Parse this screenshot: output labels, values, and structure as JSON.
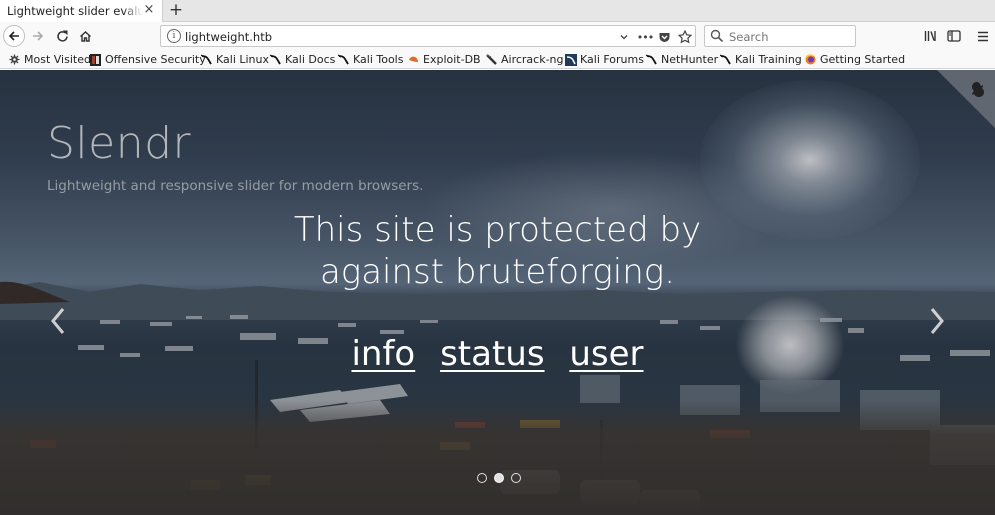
{
  "browser": {
    "tab_title": "Lightweight slider evaluation",
    "tab_close": "×",
    "new_tab": "+",
    "url": "lightweight.htb",
    "url_info": "i",
    "search_placeholder": "Search",
    "page_actions": "•••"
  },
  "bookmarks": [
    {
      "label": "Most Visited",
      "icon": "gear-icon"
    },
    {
      "label": "Offensive Security",
      "icon": "offsec-icon"
    },
    {
      "label": "Kali Linux",
      "icon": "kali-icon"
    },
    {
      "label": "Kali Docs",
      "icon": "kali-icon"
    },
    {
      "label": "Kali Tools",
      "icon": "kali-icon"
    },
    {
      "label": "Exploit-DB",
      "icon": "exploitdb-icon"
    },
    {
      "label": "Aircrack-ng",
      "icon": "aircrack-icon"
    },
    {
      "label": "Kali Forums",
      "icon": "kali-forums-icon"
    },
    {
      "label": "NetHunter",
      "icon": "kali-icon"
    },
    {
      "label": "Kali Training",
      "icon": "kali-icon"
    },
    {
      "label": "Getting Started",
      "icon": "firefox-icon"
    }
  ],
  "page": {
    "brand": "Slendr",
    "tagline": "Lightweight and responsive slider for modern browsers.",
    "notice_line1": "This site is protected by",
    "notice_line2": "against bruteforging.",
    "links": [
      "info",
      "status",
      "user"
    ],
    "slides": {
      "count": 3,
      "active": 2
    }
  }
}
